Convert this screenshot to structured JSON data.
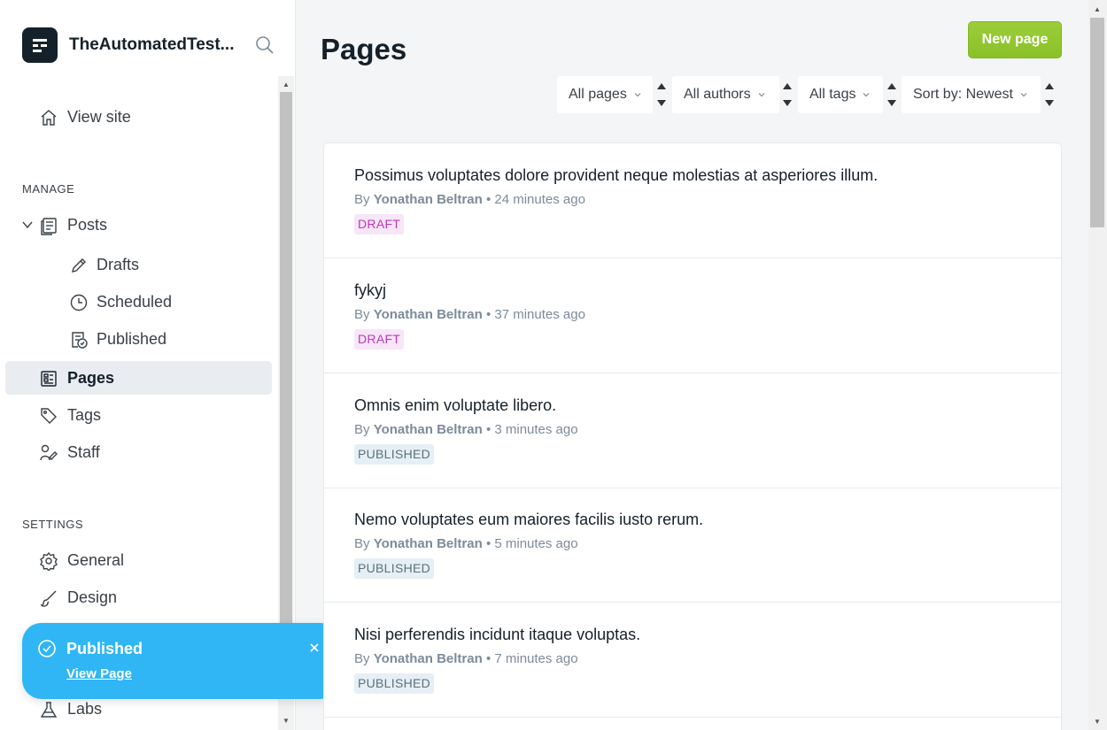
{
  "sidebar": {
    "site_title": "TheAutomatedTest...",
    "view_site": "View site",
    "manage_heading": "MANAGE",
    "posts": "Posts",
    "drafts": "Drafts",
    "scheduled": "Scheduled",
    "published": "Published",
    "pages": "Pages",
    "tags": "Tags",
    "staff": "Staff",
    "settings_heading": "SETTINGS",
    "general": "General",
    "design": "Design",
    "labs": "Labs"
  },
  "toast": {
    "title": "Published",
    "link": "View Page"
  },
  "main": {
    "title": "Pages",
    "new_button": "New page",
    "filters": {
      "type": "All pages",
      "author": "All authors",
      "tag": "All tags",
      "sort": "Sort by: Newest"
    },
    "rows": [
      {
        "title": "Possimus voluptates dolore provident neque molestias at asperiores illum.",
        "by": "By",
        "author": "Yonathan Beltran",
        "time": "• 24 minutes ago",
        "status": "DRAFT"
      },
      {
        "title": "fykyj",
        "by": "By",
        "author": "Yonathan Beltran",
        "time": "• 37 minutes ago",
        "status": "DRAFT"
      },
      {
        "title": "Omnis enim voluptate libero.",
        "by": "By",
        "author": "Yonathan Beltran",
        "time": "• 3 minutes ago",
        "status": "PUBLISHED"
      },
      {
        "title": "Nemo voluptates eum maiores facilis iusto rerum.",
        "by": "By",
        "author": "Yonathan Beltran",
        "time": "• 5 minutes ago",
        "status": "PUBLISHED"
      },
      {
        "title": "Nisi perferendis incidunt itaque voluptas.",
        "by": "By",
        "author": "Yonathan Beltran",
        "time": "• 7 minutes ago",
        "status": "PUBLISHED"
      }
    ]
  },
  "colors": {
    "accent": "#30b6f5",
    "primary_button": "#94c731",
    "draft_badge": "#bd36ba",
    "published_badge": "#5d7079"
  }
}
